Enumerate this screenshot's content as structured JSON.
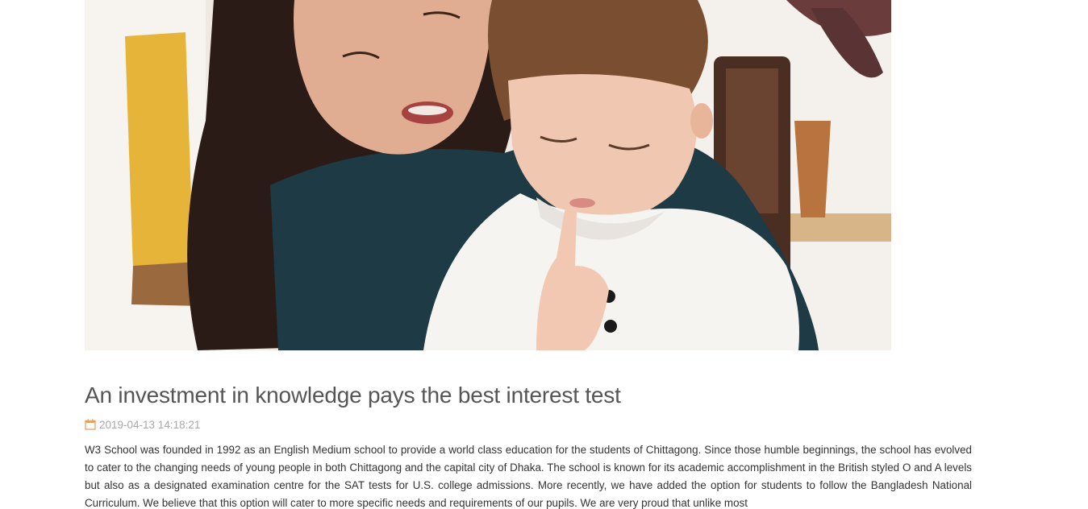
{
  "hero": {
    "alt": "Mother and young boy reading together"
  },
  "article": {
    "title": "An investment in knowledge pays the best interest test",
    "date_icon": "calendar-icon",
    "date": "2019-04-13 14:18:21",
    "body": "W3 School was founded in 1992 as an English Medium school to provide a world class education for the students of Chittagong. Since those humble beginnings, the school has evolved to cater to the changing needs of young people in both Chittagong and the capital city of Dhaka. The school is known for its academic accomplishment in the British styled O and A levels but also as a designated examination centre for the SAT tests for U.S. college admissions. More recently, we have added the option for students to follow the Bangladesh National Curriculum. We believe that this option will cater to more specific needs and requirements of our pupils. We are very proud that unlike most"
  },
  "colors": {
    "title": "#555555",
    "meta": "#a8a8a8",
    "calendar_icon": "#e8a05f",
    "body": "#333333"
  }
}
